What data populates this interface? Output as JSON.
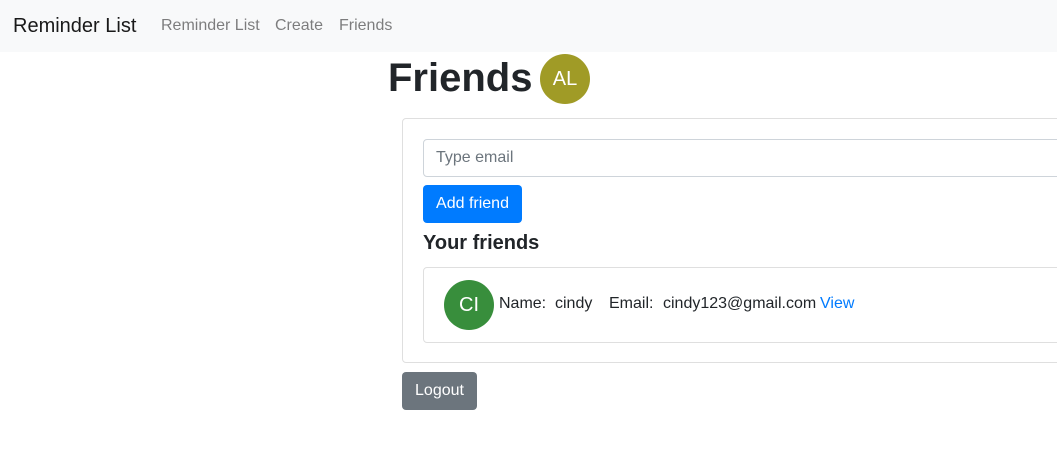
{
  "navbar": {
    "brand": "Reminder List",
    "links": [
      "Reminder List",
      "Create",
      "Friends"
    ]
  },
  "page": {
    "title": "Friends",
    "user_avatar": {
      "initials": "AL",
      "color": "#a09b26"
    }
  },
  "add_friend": {
    "email_placeholder": "Type email",
    "email_value": "",
    "button_label": "Add friend"
  },
  "friends_section": {
    "title": "Your friends",
    "items": [
      {
        "initials": "CI",
        "avatar_color": "#388e3c",
        "name_label": "Name:",
        "name": "cindy",
        "email_label": "Email:",
        "email": "cindy123@gmail.com",
        "view_label": "View"
      }
    ]
  },
  "logout_label": "Logout",
  "colors": {
    "primary": "#007bff",
    "secondary": "#6c757d",
    "navbar_bg": "#f8f9fa"
  }
}
